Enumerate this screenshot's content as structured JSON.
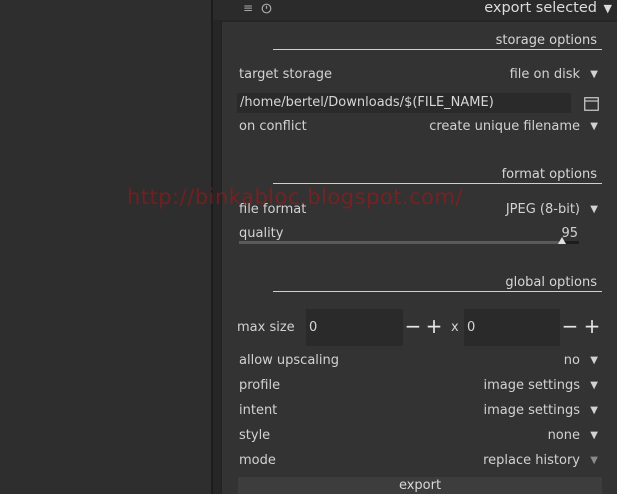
{
  "header": {
    "title": "export selected",
    "menu_icon": "hamburger-icon",
    "reset_icon": "reset-icon",
    "collapse_icon": "triangle-down-icon"
  },
  "storage": {
    "section_title": "storage options",
    "target_label": "target storage",
    "target_value": "file on disk",
    "path_value": "/home/bertel/Downloads/$(FILE_NAME)",
    "folder_icon": "folder-icon",
    "conflict_label": "on conflict",
    "conflict_value": "create unique filename"
  },
  "format": {
    "section_title": "format options",
    "file_format_label": "file format",
    "file_format_value": "JPEG (8-bit)",
    "quality_label": "quality",
    "quality_value": "95",
    "quality_fraction": 0.95
  },
  "global": {
    "section_title": "global options",
    "max_size_label": "max size",
    "width_value": "0",
    "height_value": "0",
    "separator": "x",
    "minus_glyph": "−",
    "plus_glyph": "+",
    "upscaling_label": "allow upscaling",
    "upscaling_value": "no",
    "profile_label": "profile",
    "profile_value": "image settings",
    "intent_label": "intent",
    "intent_value": "image settings",
    "style_label": "style",
    "style_value": "none",
    "mode_label": "mode",
    "mode_value": "replace history"
  },
  "export_button": "export",
  "watermark": "http://binkabloc.blogspot.com/",
  "colors": {
    "panel_bg": "#333333",
    "field_bg": "#2a2a2a",
    "watermark": "#aa1414"
  }
}
